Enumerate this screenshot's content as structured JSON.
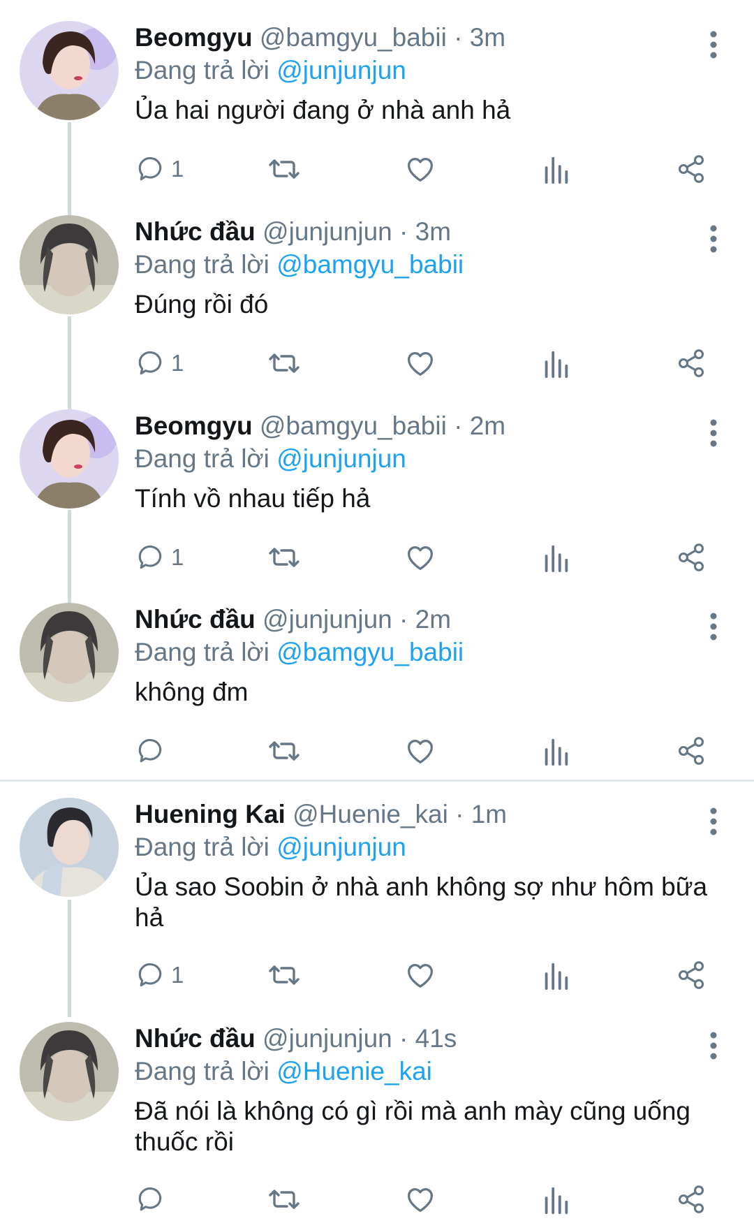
{
  "labels": {
    "replying_to": "Đang trả lời"
  },
  "colors": {
    "text_primary": "#14171a",
    "text_secondary": "#657786",
    "mention": "#1da1f2",
    "thread_line": "#cfd9de"
  },
  "icons": {
    "reply": "reply-icon",
    "retweet": "retweet-icon",
    "like": "heart-icon",
    "analytics": "analytics-icon",
    "share": "share-icon",
    "more": "more-vertical-icon"
  },
  "tweets": [
    {
      "name": "Beomgyu",
      "handle": "@bamgyu_babii",
      "time": "3m",
      "reply_to": "@junjunjun",
      "text": "Ủa hai người đang ở nhà anh hả",
      "reply_count": "1"
    },
    {
      "name": "Nhức đầu",
      "handle": "@junjunjun",
      "time": "3m",
      "reply_to": "@bamgyu_babii",
      "text": "Đúng rồi đó",
      "reply_count": "1"
    },
    {
      "name": "Beomgyu",
      "handle": "@bamgyu_babii",
      "time": "2m",
      "reply_to": "@junjunjun",
      "text": "Tính vồ nhau tiếp hả",
      "reply_count": "1"
    },
    {
      "name": "Nhức đầu",
      "handle": "@junjunjun",
      "time": "2m",
      "reply_to": "@bamgyu_babii",
      "text": "không đm",
      "reply_count": ""
    },
    {
      "name": "Huening Kai",
      "handle": "@Huenie_kai",
      "time": "1m",
      "reply_to": "@junjunjun",
      "text": "Ủa sao Soobin ở nhà anh không sợ như hôm bữa hả",
      "reply_count": "1"
    },
    {
      "name": "Nhức đầu",
      "handle": "@junjunjun",
      "time": "41s",
      "reply_to": "@Huenie_kai",
      "text": "Đã nói là không có gì rồi mà anh mày cũng uống thuốc rồi",
      "reply_count": ""
    }
  ]
}
